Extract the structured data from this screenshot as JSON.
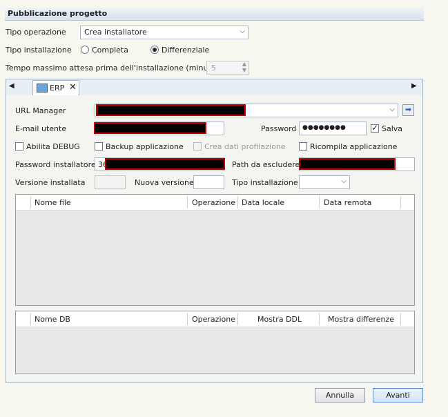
{
  "header": {
    "title": "Pubblicazione progetto"
  },
  "form": {
    "tipo_operazione_label": "Tipo operazione",
    "tipo_operazione_value": "Crea installatore",
    "tipo_installazione_label": "Tipo installazione",
    "radio_completa": "Completa",
    "radio_differenziale": "Differenziale",
    "tempo_label": "Tempo massimo attesa prima dell'installazione (minuti)",
    "tempo_value": "5"
  },
  "tab": {
    "label": "ERP"
  },
  "erp": {
    "url_manager_label": "URL Manager",
    "email_label": "E-mail utente",
    "password_label": "Password",
    "password_value": "●●●●●●●●",
    "salva_label": "Salva",
    "abilita_debug": "Abilita DEBUG",
    "backup_applicazione": "Backup applicazione",
    "crea_dati_profilazione": "Crea dati profilazione",
    "ricompila_applicazione": "Ricompila applicazione",
    "password_installatore_label": "Password installatore",
    "password_installatore_prefix": "36",
    "path_da_escludere_label": "Path da escludere",
    "versione_installata_label": "Versione installata",
    "nuova_versione_label": "Nuova versione",
    "tipo_installazione_label": "Tipo installazione"
  },
  "files_grid": {
    "columns": [
      "Nome file",
      "Operazione",
      "Data locale",
      "Data remota"
    ]
  },
  "db_grid": {
    "columns": [
      "Nome DB",
      "Operazione",
      "Mostra DDL",
      "Mostra differenze"
    ]
  },
  "buttons": {
    "annulla": "Annulla",
    "avanti": "Avanti"
  }
}
